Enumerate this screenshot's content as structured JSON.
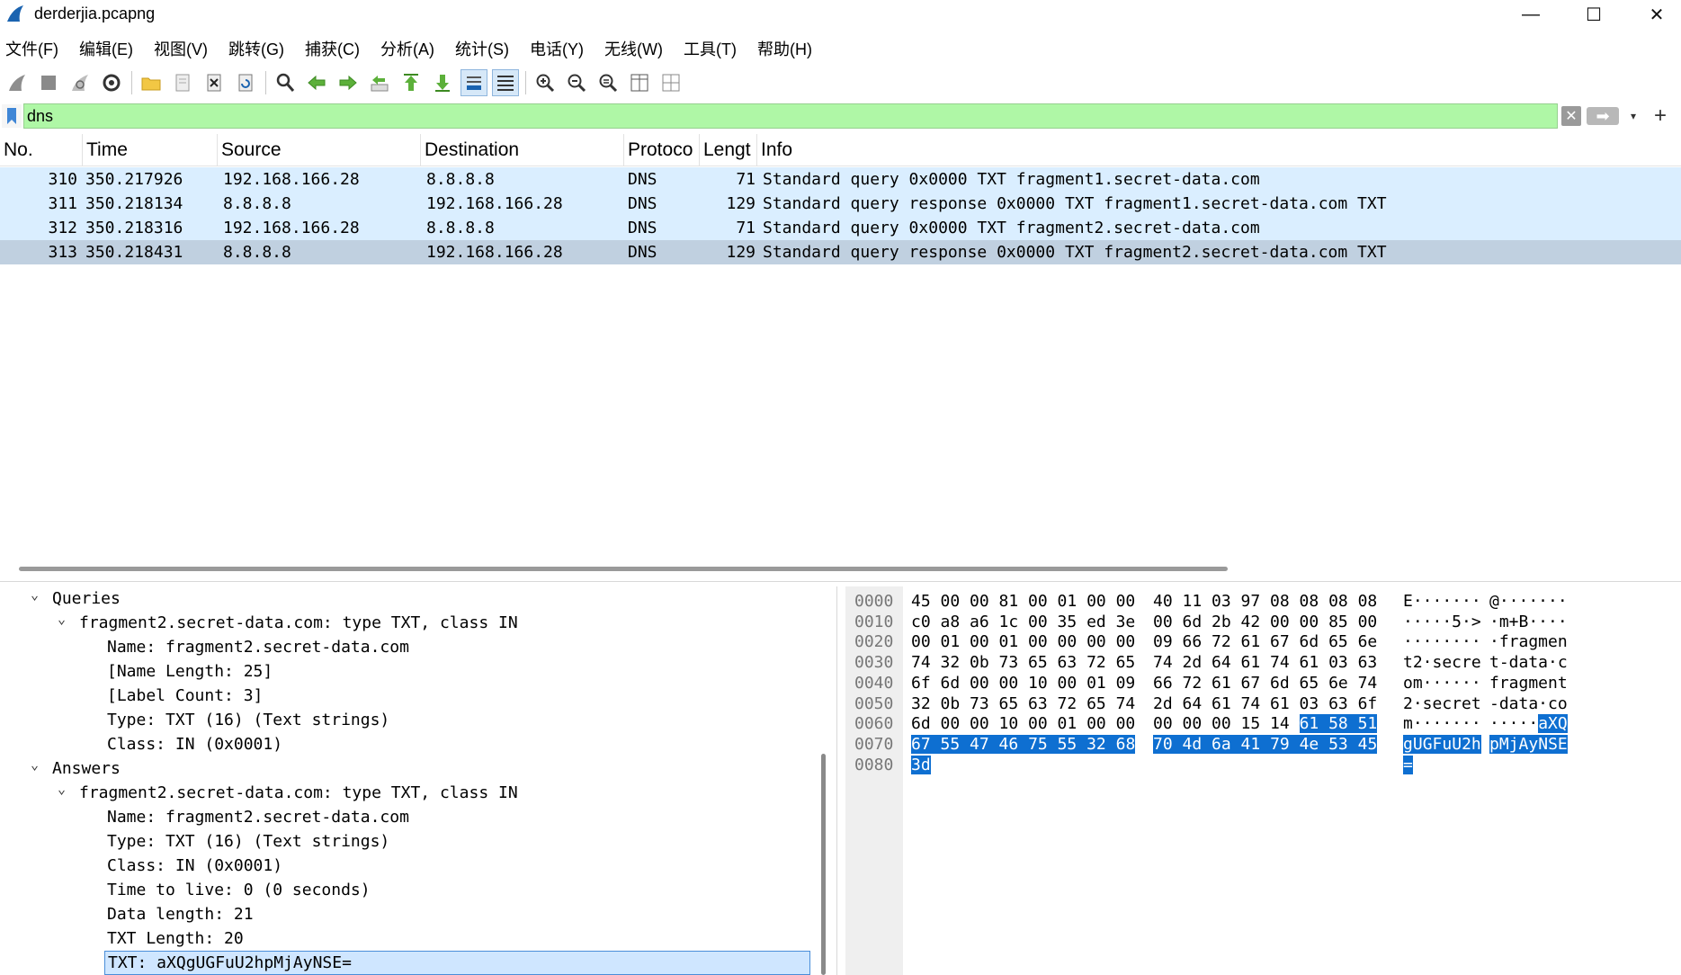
{
  "window": {
    "title": "derderjia.pcapng",
    "minimize": "—",
    "maximize": "☐",
    "close": "✕"
  },
  "menu": [
    "文件(F)",
    "编辑(E)",
    "视图(V)",
    "跳转(G)",
    "捕获(C)",
    "分析(A)",
    "统计(S)",
    "电话(Y)",
    "无线(W)",
    "工具(T)",
    "帮助(H)"
  ],
  "filter": {
    "value": "dns",
    "clear_icon": "✕",
    "apply_icon": "➡",
    "dropdown_icon": "▾",
    "add_icon": "+"
  },
  "packet_list": {
    "columns": [
      "No.",
      "Time",
      "Source",
      "Destination",
      "Protoco",
      "Lengt",
      "Info"
    ],
    "rows": [
      {
        "no": "310",
        "time": "350.217926",
        "src": "192.168.166.28",
        "dst": "8.8.8.8",
        "proto": "DNS",
        "len": "71",
        "info": "Standard query 0x0000 TXT fragment1.secret-data.com"
      },
      {
        "no": "311",
        "time": "350.218134",
        "src": "8.8.8.8",
        "dst": "192.168.166.28",
        "proto": "DNS",
        "len": "129",
        "info": "Standard query response 0x0000 TXT fragment1.secret-data.com TXT"
      },
      {
        "no": "312",
        "time": "350.218316",
        "src": "192.168.166.28",
        "dst": "8.8.8.8",
        "proto": "DNS",
        "len": "71",
        "info": "Standard query 0x0000 TXT fragment2.secret-data.com"
      },
      {
        "no": "313",
        "time": "350.218431",
        "src": "8.8.8.8",
        "dst": "192.168.166.28",
        "proto": "DNS",
        "len": "129",
        "info": "Standard query response 0x0000 TXT fragment2.secret-data.com TXT"
      }
    ],
    "selected_index": 3
  },
  "details": {
    "expanded_icon": "⌄",
    "lines": [
      {
        "level": 0,
        "chev": true,
        "text": "Queries"
      },
      {
        "level": 1,
        "chev": true,
        "text": "fragment2.secret-data.com: type TXT, class IN"
      },
      {
        "level": 2,
        "chev": false,
        "text": "Name: fragment2.secret-data.com"
      },
      {
        "level": 2,
        "chev": false,
        "text": "[Name Length: 25]"
      },
      {
        "level": 2,
        "chev": false,
        "text": "[Label Count: 3]"
      },
      {
        "level": 2,
        "chev": false,
        "text": "Type: TXT (16) (Text strings)"
      },
      {
        "level": 2,
        "chev": false,
        "text": "Class: IN (0x0001)"
      },
      {
        "level": 0,
        "chev": true,
        "text": "Answers"
      },
      {
        "level": 1,
        "chev": true,
        "text": "fragment2.secret-data.com: type TXT, class IN"
      },
      {
        "level": 2,
        "chev": false,
        "text": "Name: fragment2.secret-data.com"
      },
      {
        "level": 2,
        "chev": false,
        "text": "Type: TXT (16) (Text strings)"
      },
      {
        "level": 2,
        "chev": false,
        "text": "Class: IN (0x0001)"
      },
      {
        "level": 2,
        "chev": false,
        "text": "Time to live: 0 (0 seconds)"
      },
      {
        "level": 2,
        "chev": false,
        "text": "Data length: 21"
      },
      {
        "level": 2,
        "chev": false,
        "text": "TXT Length: 20"
      },
      {
        "level": 2,
        "chev": false,
        "text": "TXT: aXQgUGFuU2hpMjAyNSE=",
        "selected": true
      }
    ]
  },
  "bytes": {
    "rows": [
      {
        "off": "0000",
        "h1": "45 00 00 81 00 01 00 00",
        "h2": "40 11 03 97 08 08 08 08",
        "a1": "E·······",
        "a2": "@·······",
        "hl_from": -1
      },
      {
        "off": "0010",
        "h1": "c0 a8 a6 1c 00 35 ed 3e",
        "h2": "00 6d 2b 42 00 00 85 00",
        "a1": "·····5·>",
        "a2": "·m+B····",
        "hl_from": -1
      },
      {
        "off": "0020",
        "h1": "00 01 00 01 00 00 00 00",
        "h2": "09 66 72 61 67 6d 65 6e",
        "a1": "········",
        "a2": "·fragmen",
        "hl_from": -1
      },
      {
        "off": "0030",
        "h1": "74 32 0b 73 65 63 72 65",
        "h2": "74 2d 64 61 74 61 03 63",
        "a1": "t2·secre",
        "a2": "t-data·c",
        "hl_from": -1
      },
      {
        "off": "0040",
        "h1": "6f 6d 00 00 10 00 01 09",
        "h2": "66 72 61 67 6d 65 6e 74",
        "a1": "om······",
        "a2": "fragment",
        "hl_from": -1
      },
      {
        "off": "0050",
        "h1": "32 0b 73 65 63 72 65 74",
        "h2": "2d 64 61 74 61 03 63 6f",
        "a1": "2·secret",
        "a2": "-data·co",
        "hl_from": -1
      },
      {
        "off": "0060",
        "h1": "6d 00 00 10 00 01 00 00",
        "h2": "00 00 00 15 14 61 58 51",
        "a1": "m·······",
        "a2": "·····aXQ",
        "hl_from": 13
      },
      {
        "off": "0070",
        "h1": "67 55 47 46 75 55 32 68",
        "h2": "70 4d 6a 41 79 4e 53 45",
        "a1": "gUGFuU2h",
        "a2": "pMjAyNSE",
        "hl_from": 0
      },
      {
        "off": "0080",
        "h1": "3d",
        "h2": "",
        "a1": "=",
        "a2": "",
        "hl_from": 0
      }
    ]
  }
}
